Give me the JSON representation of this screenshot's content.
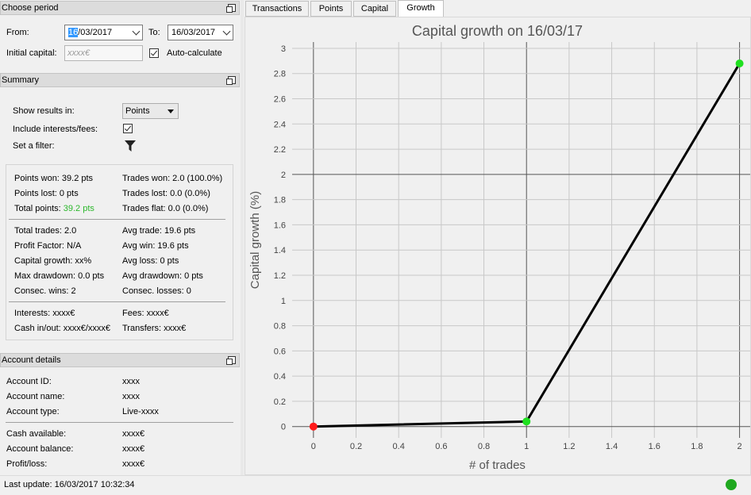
{
  "period": {
    "header": "Choose period",
    "from_label": "From:",
    "from_value_selected": "16",
    "from_value_rest": "/03/2017",
    "to_label": "To:",
    "to_value": "16/03/2017",
    "capital_label": "Initial capital:",
    "capital_placeholder": "xxxx€",
    "auto_label": "Auto-calculate"
  },
  "summary": {
    "header": "Summary",
    "show_results_label": "Show results in:",
    "show_results_value": "Points",
    "include_label": "Include interests/fees:",
    "filter_label": "Set a filter:",
    "stats": {
      "points_won": "Points won: 39.2 pts",
      "points_lost": "Points lost: 0 pts",
      "total_points_label": "Total points: ",
      "total_points_value": "39.2 pts",
      "trades_won": "Trades won: 2.0 (100.0%)",
      "trades_lost": "Trades lost: 0.0 (0.0%)",
      "trades_flat": "Trades flat: 0.0 (0.0%)",
      "total_trades": "Total trades: 2.0",
      "profit_factor": "Profit Factor: N/A",
      "capital_growth": "Capital growth: xx%",
      "max_drawdown": "Max drawdown: 0.0 pts",
      "consec_wins": "Consec. wins: 2",
      "avg_trade": "Avg trade: 19.6 pts",
      "avg_win": "Avg win: 19.6 pts",
      "avg_loss": "Avg loss: 0 pts",
      "avg_drawdown": "Avg drawdown: 0 pts",
      "consec_losses": "Consec. losses: 0",
      "interests": "Interests: xxxx€",
      "cash_inout": "Cash in/out: xxxx€/xxxx€",
      "fees": "Fees: xxxx€",
      "transfers": "Transfers: xxxx€"
    }
  },
  "account": {
    "header": "Account details",
    "rows": [
      {
        "label": "Account ID:",
        "value": "xxxx"
      },
      {
        "label": "Account name:",
        "value": "xxxx"
      },
      {
        "label": "Account type:",
        "value": "Live-xxxx"
      },
      {
        "label": "Cash available:",
        "value": "xxxx€"
      },
      {
        "label": "Account balance:",
        "value": "xxxx€"
      },
      {
        "label": "Profit/loss:",
        "value": "xxxx€"
      }
    ]
  },
  "tabs": [
    "Transactions",
    "Points",
    "Capital",
    "Growth"
  ],
  "active_tab": "Growth",
  "status": {
    "last_update": "Last update: 16/03/2017 10:32:34",
    "connection_color": "#1fa81f"
  },
  "colors": {
    "positive": "#2db82d",
    "point_start": "#ff1a1a",
    "point_normal": "#1fe01f"
  },
  "chart_data": {
    "type": "line",
    "title": "Capital growth on 16/03/17",
    "xlabel": "# of trades",
    "ylabel": "Capital growth (%)",
    "xlim": [
      -0.1,
      2.05
    ],
    "ylim": [
      -0.09,
      3.05
    ],
    "xticks": [
      "0",
      "0.2",
      "0.4",
      "0.6",
      "0.8",
      "1",
      "1.2",
      "1.4",
      "1.6",
      "1.8",
      "2"
    ],
    "yticks": [
      "0",
      "0.2",
      "0.4",
      "0.6",
      "0.8",
      "1",
      "1.2",
      "1.4",
      "1.6",
      "1.8",
      "2",
      "2.2",
      "2.4",
      "2.6",
      "2.8",
      "3"
    ],
    "grid": true,
    "series": [
      {
        "x": [
          0,
          1,
          2
        ],
        "y": [
          0,
          0.04,
          2.88
        ]
      }
    ]
  }
}
